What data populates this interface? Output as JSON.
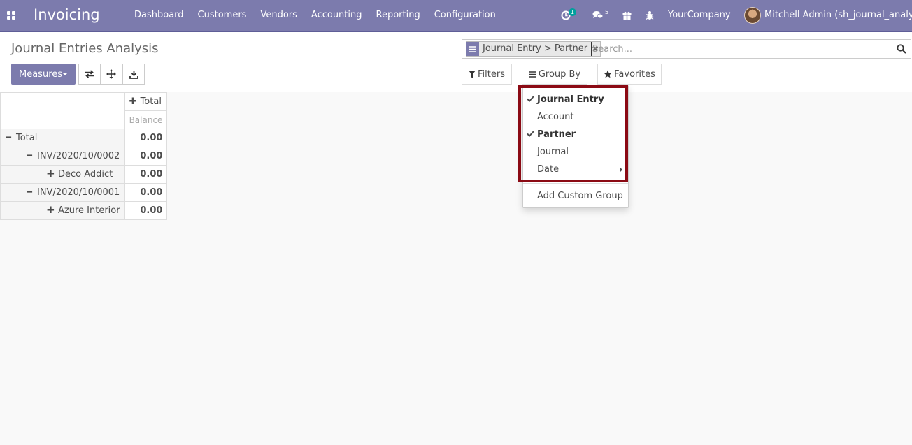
{
  "navbar": {
    "app_name": "Invoicing",
    "menu": [
      "Dashboard",
      "Customers",
      "Vendors",
      "Accounting",
      "Reporting",
      "Configuration"
    ],
    "activity_count": "1",
    "messages_count": "5",
    "company": "YourCompany",
    "user": "Mitchell Admin (sh_journal_analysis)",
    "color": "#7c7bad"
  },
  "page": {
    "title": "Journal Entries Analysis"
  },
  "toolbar": {
    "measures_label": "Measures",
    "flip_icon": "exchange-icon",
    "expand_icon": "arrows-icon",
    "download_icon": "download-icon"
  },
  "search": {
    "facet_label": "Journal Entry > Partner",
    "placeholder": "Search..."
  },
  "filters": {
    "filters_label": "Filters",
    "groupby_label": "Group By",
    "favorites_label": "Favorites"
  },
  "groupby_menu": {
    "items": [
      {
        "label": "Journal Entry",
        "selected": true
      },
      {
        "label": "Account",
        "selected": false
      },
      {
        "label": "Partner",
        "selected": true
      },
      {
        "label": "Journal",
        "selected": false
      },
      {
        "label": "Date",
        "selected": false,
        "submenu": true
      }
    ],
    "custom_label": "Add Custom Group",
    "highlight_color": "#8b0a14"
  },
  "pivot": {
    "col_header": "Total",
    "measure": "Balance",
    "rows": [
      {
        "label": "Total",
        "sign": "minus",
        "value": "0.00"
      },
      {
        "label": "INV/2020/10/0002",
        "sign": "minus",
        "value": "0.00"
      },
      {
        "label": "Deco Addict",
        "sign": "plus",
        "value": "0.00"
      },
      {
        "label": "INV/2020/10/0001",
        "sign": "minus",
        "value": "0.00"
      },
      {
        "label": "Azure Interior",
        "sign": "plus",
        "value": "0.00"
      }
    ]
  }
}
